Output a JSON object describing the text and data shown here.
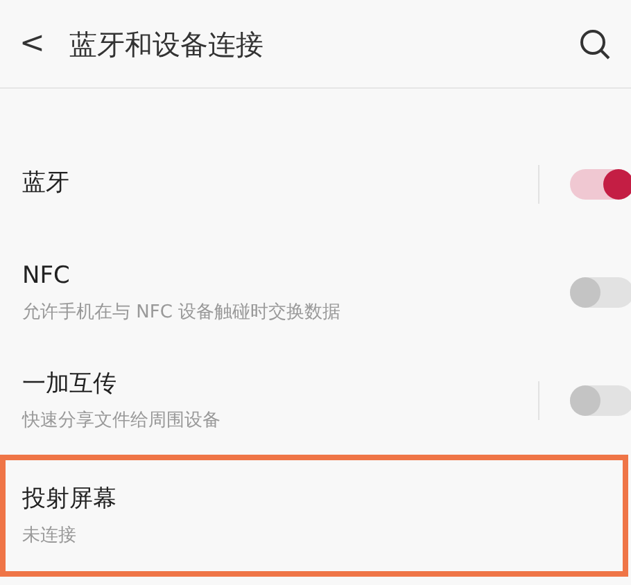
{
  "header": {
    "back": "<",
    "title": "蓝牙和设备连接"
  },
  "items": [
    {
      "kind": "toggle",
      "title": "蓝牙",
      "on": true,
      "divider": true,
      "highlighted": false
    },
    {
      "kind": "toggle",
      "title": "NFC",
      "subtitle": "允许手机在与 NFC 设备触碰时交换数据",
      "on": false,
      "divider": false,
      "highlighted": false
    },
    {
      "kind": "toggle",
      "title": "一加互传",
      "subtitle": "快速分享文件给周围设备",
      "on": false,
      "divider": true,
      "highlighted": false
    },
    {
      "kind": "link",
      "title": "投射屏幕",
      "subtitle": "未连接",
      "highlighted": true
    }
  ]
}
